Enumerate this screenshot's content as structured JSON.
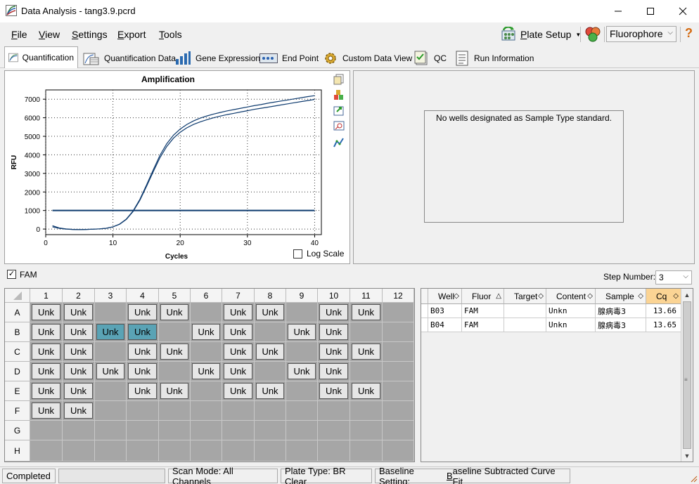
{
  "window": {
    "title": "Data Analysis - tang3.9.pcrd"
  },
  "menu": [
    {
      "label": "File",
      "u": "F",
      "rest": "ile"
    },
    {
      "label": "View",
      "u": "V",
      "rest": "iew"
    },
    {
      "label": "Settings",
      "u": "S",
      "rest": "ettings"
    },
    {
      "label": "Export",
      "u": "E",
      "rest": "xport"
    },
    {
      "label": "Tools",
      "u": "T",
      "rest": "ools"
    }
  ],
  "toolbar": {
    "plate_setup_u": "P",
    "plate_setup_rest": "late Setup",
    "fluorophore": "Fluorophore",
    "help": "?"
  },
  "tabs": [
    "Quantification",
    "Quantification Data",
    "Gene Expression",
    "End Point",
    "Custom Data View",
    "QC",
    "Run Information"
  ],
  "chart_data": {
    "type": "line",
    "title": "Amplification",
    "xlabel": "Cycles",
    "ylabel": "RFU",
    "xlim": [
      0,
      41
    ],
    "ylim": [
      -300,
      7500
    ],
    "xticks": [
      0,
      10,
      20,
      30,
      40
    ],
    "yticks": [
      0,
      1000,
      2000,
      3000,
      4000,
      5000,
      6000,
      7000
    ],
    "grid": true,
    "threshold": 1000,
    "series": [
      {
        "x": [
          1,
          2,
          3,
          4,
          5,
          6,
          7,
          8,
          9,
          10,
          11,
          12,
          13,
          14,
          15,
          16,
          17,
          18,
          19,
          20,
          21,
          22,
          23,
          24,
          25,
          26,
          27,
          28,
          29,
          30,
          31,
          32,
          33,
          34,
          35,
          36,
          37,
          38,
          39,
          40
        ],
        "values": [
          180,
          60,
          10,
          -20,
          -30,
          -20,
          -10,
          10,
          40,
          120,
          260,
          520,
          950,
          1550,
          2300,
          3100,
          3850,
          4450,
          4900,
          5220,
          5460,
          5640,
          5780,
          5900,
          6000,
          6090,
          6170,
          6240,
          6310,
          6380,
          6450,
          6510,
          6570,
          6630,
          6690,
          6750,
          6810,
          6870,
          6930,
          6990
        ]
      },
      {
        "x": [
          1,
          2,
          3,
          4,
          5,
          6,
          7,
          8,
          9,
          10,
          11,
          12,
          13,
          14,
          15,
          16,
          17,
          18,
          19,
          20,
          21,
          22,
          23,
          24,
          25,
          26,
          27,
          28,
          29,
          30,
          31,
          32,
          33,
          34,
          35,
          36,
          37,
          38,
          39,
          40
        ],
        "values": [
          120,
          40,
          0,
          -20,
          -30,
          -20,
          -10,
          10,
          40,
          120,
          270,
          540,
          980,
          1600,
          2380,
          3200,
          3980,
          4600,
          5060,
          5390,
          5640,
          5830,
          5980,
          6100,
          6200,
          6290,
          6370,
          6440,
          6510,
          6580,
          6650,
          6710,
          6780,
          6840,
          6900,
          6960,
          7020,
          7080,
          7140,
          7190
        ]
      }
    ]
  },
  "log_scale": {
    "label": "Log Scale",
    "checked": false
  },
  "standard_curve": {
    "message": "No wells designated as Sample Type standard."
  },
  "fam": {
    "label": "FAM",
    "checked": true
  },
  "step": {
    "label": "Step Number:",
    "value": "3"
  },
  "plate": {
    "cols": [
      "1",
      "2",
      "3",
      "4",
      "5",
      "6",
      "7",
      "8",
      "9",
      "10",
      "11",
      "12"
    ],
    "rows": [
      "A",
      "B",
      "C",
      "D",
      "E",
      "F",
      "G",
      "H"
    ],
    "well_label": "Unk",
    "wells": {
      "A": [
        "Unk",
        "Unk",
        "",
        "Unk",
        "Unk",
        "",
        "Unk",
        "Unk",
        "",
        "Unk",
        "Unk",
        ""
      ],
      "B": [
        "Unk",
        "Unk",
        "Unk*",
        "Unk*",
        "",
        "Unk",
        "Unk",
        "",
        "Unk",
        "Unk",
        "",
        ""
      ],
      "C": [
        "Unk",
        "Unk",
        "",
        "Unk",
        "Unk",
        "",
        "Unk",
        "Unk",
        "",
        "Unk",
        "Unk",
        ""
      ],
      "D": [
        "Unk",
        "Unk",
        "Unk",
        "Unk",
        "",
        "Unk",
        "Unk",
        "",
        "Unk",
        "Unk",
        "",
        ""
      ],
      "E": [
        "Unk",
        "Unk",
        "",
        "Unk",
        "Unk",
        "",
        "Unk",
        "Unk",
        "",
        "Unk",
        "Unk",
        ""
      ],
      "F": [
        "Unk",
        "Unk",
        "",
        "",
        "",
        "",
        "",
        "",
        "",
        "",
        "",
        ""
      ],
      "G": [
        "",
        "",
        "",
        "",
        "",
        "",
        "",
        "",
        "",
        "",
        "",
        ""
      ],
      "H": [
        "",
        "",
        "",
        "",
        "",
        "",
        "",
        "",
        "",
        "",
        "",
        ""
      ]
    }
  },
  "table": {
    "headers": [
      "Well",
      "Fluor",
      "Target",
      "Content",
      "Sample",
      "Cq"
    ],
    "rows": [
      [
        "B03",
        "FAM",
        "",
        "Unkn",
        "腺病毒3",
        "13.66"
      ],
      [
        "B04",
        "FAM",
        "",
        "Unkn",
        "腺病毒3",
        "13.65"
      ]
    ]
  },
  "status": {
    "state": "Completed",
    "scan_mode": "Scan Mode: All Channels",
    "plate_type": "Plate Type: BR Clear",
    "baseline_prefix": "Baseline Setting: ",
    "baseline_u": "B",
    "baseline_rest": "aseline Subtracted Curve Fit"
  },
  "colors": {
    "curve": "#0d3a6e",
    "selected_well": "#5aa3b5",
    "active_header": "#fbd494"
  }
}
